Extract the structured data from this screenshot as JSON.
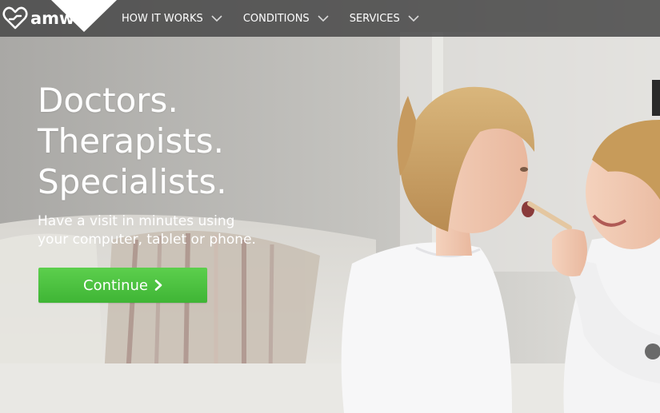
{
  "brand": {
    "logo_text": "amw",
    "logo_icon": "heart-logo-icon"
  },
  "nav": {
    "items": [
      {
        "label": "HOW IT WORKS",
        "icon": "chevron-down-icon"
      },
      {
        "label": "CONDITIONS",
        "icon": "chevron-down-icon"
      },
      {
        "label": "SERVICES",
        "icon": "chevron-down-icon"
      }
    ]
  },
  "hero": {
    "headline": [
      "Doctors.",
      "Therapists.",
      "Specialists."
    ],
    "subhead": [
      "Have a visit in minutes using",
      "your computer, tablet or phone."
    ],
    "cta_label": "Continue",
    "cta_icon": "chevron-right-icon"
  },
  "colors": {
    "nav_bg": "#484848",
    "cta_green": "#4cc243",
    "text": "#ffffff"
  }
}
